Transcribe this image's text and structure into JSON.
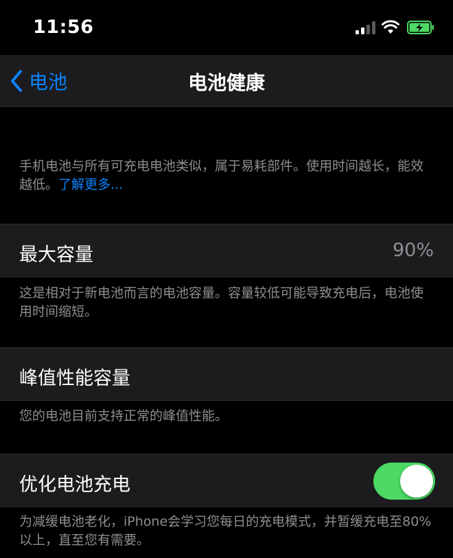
{
  "status_bar": {
    "time": "11:56",
    "signal_bars_active": 2,
    "signal_bars_total": 4,
    "battery_charging": true,
    "battery_color": "#4cd964"
  },
  "nav": {
    "back_label": "电池",
    "title": "电池健康",
    "accent_color": "#0a84ff"
  },
  "intro": {
    "text": "手机电池与所有可充电电池类似，属于易耗部件。使用时间越长，能效越低。",
    "link": "了解更多..."
  },
  "max_capacity": {
    "label": "最大容量",
    "value": "90%",
    "description": "这是相对于新电池而言的电池容量。容量较低可能导致充电后，电池使用时间缩短。"
  },
  "peak_performance": {
    "label": "峰值性能容量",
    "description": "您的电池目前支持正常的峰值性能。"
  },
  "optimized_charging": {
    "label": "优化电池充电",
    "enabled": true,
    "toggle_color": "#4cd964",
    "description": "为减缓电池老化，iPhone会学习您每日的充电模式，并暂缓充电至80%以上，直至您有需要。"
  },
  "icons": [
    "signal-icon",
    "wifi-icon",
    "battery-charging-icon",
    "chevron-left-icon"
  ]
}
